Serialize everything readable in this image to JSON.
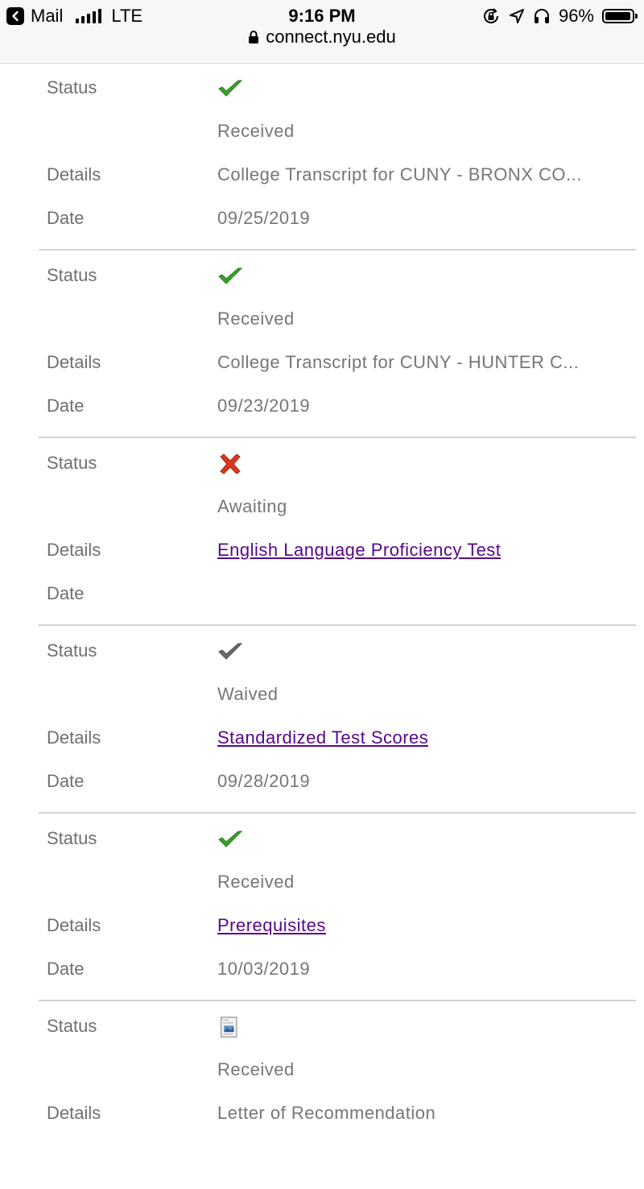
{
  "statusbar": {
    "app": "Mail",
    "network": "LTE",
    "time": "9:16 PM",
    "url": "connect.nyu.edu",
    "battery": "96%"
  },
  "labels": {
    "status": "Status",
    "details": "Details",
    "date": "Date"
  },
  "records": [
    {
      "icon": "green-check-icon",
      "status": "Received",
      "details": "College Transcript for CUNY - BRONX CO...",
      "details_is_link": false,
      "date": "09/25/2019"
    },
    {
      "icon": "green-check-icon",
      "status": "Received",
      "details": "College Transcript for CUNY - HUNTER C...",
      "details_is_link": false,
      "date": "09/23/2019"
    },
    {
      "icon": "red-x-icon",
      "status": "Awaiting",
      "details": "English Language Proficiency Test",
      "details_is_link": true,
      "date": ""
    },
    {
      "icon": "gray-check-icon",
      "status": "Waived",
      "details": "Standardized Test Scores",
      "details_is_link": true,
      "date": "09/28/2019"
    },
    {
      "icon": "green-check-icon",
      "status": "Received",
      "details": "Prerequisites",
      "details_is_link": true,
      "date": "10/03/2019"
    },
    {
      "icon": "document-icon",
      "status": "Received",
      "details": "Letter of Recommendation",
      "details_is_link": false,
      "date": ""
    }
  ],
  "colors": {
    "link": "#57068c",
    "check_green": "#3aa02a",
    "x_red": "#d9381e",
    "check_gray": "#6a6a6a"
  }
}
